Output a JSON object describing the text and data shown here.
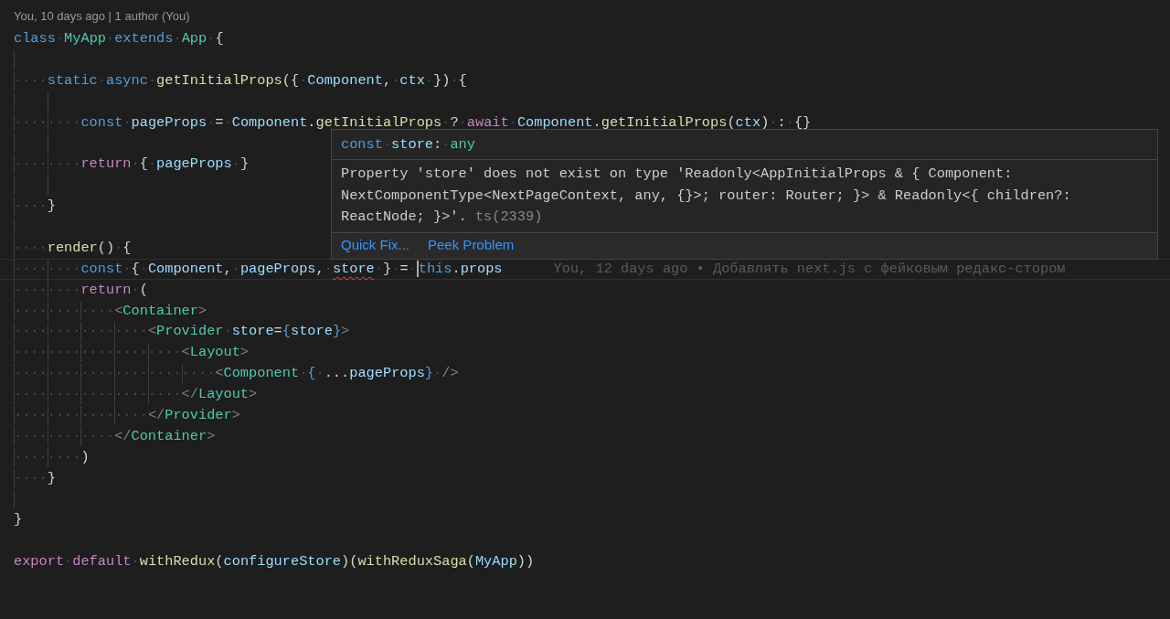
{
  "codelens": "You, 10 days ago | 1 author (You)",
  "lines": [
    {
      "current": false,
      "tokens": [
        {
          "kind": "keyword",
          "text": "class·"
        },
        {
          "kind": "type",
          "text": "MyApp·"
        },
        {
          "kind": "keyword",
          "text": "extends·"
        },
        {
          "kind": "type",
          "text": "App·"
        },
        {
          "kind": "punct",
          "text": "{"
        }
      ]
    },
    {
      "current": false
    },
    {
      "current": false,
      "tokens": [
        {
          "kind": "indent",
          "text": "····"
        },
        {
          "kind": "keyword",
          "text": "static·"
        },
        {
          "kind": "keyword",
          "text": "async·"
        },
        {
          "kind": "function",
          "text": "getInitialProps"
        },
        {
          "kind": "punct",
          "text": "({·"
        },
        {
          "kind": "variable",
          "text": "Component"
        },
        {
          "kind": "punct",
          "text": ",·"
        },
        {
          "kind": "variable",
          "text": "ctx·"
        },
        {
          "kind": "punct",
          "text": "})·{"
        }
      ]
    },
    {
      "current": false
    },
    {
      "current": false,
      "tokens": [
        {
          "kind": "indent",
          "text": "········"
        },
        {
          "kind": "keyword",
          "text": "const·"
        },
        {
          "kind": "variable",
          "text": "pageProps·"
        },
        {
          "kind": "punct",
          "text": "=·"
        },
        {
          "kind": "variable",
          "text": "Component"
        },
        {
          "kind": "punct",
          "text": "."
        },
        {
          "kind": "function",
          "text": "getInitialProps·"
        },
        {
          "kind": "punct",
          "text": "?·"
        },
        {
          "kind": "control",
          "text": "await·"
        },
        {
          "kind": "variable",
          "text": "Component"
        },
        {
          "kind": "punct",
          "text": "."
        },
        {
          "kind": "function",
          "text": "getInitialProps"
        },
        {
          "kind": "punct",
          "text": "("
        },
        {
          "kind": "variable",
          "text": "ctx"
        },
        {
          "kind": "punct",
          "text": ")·:·{}"
        }
      ]
    },
    {
      "current": false
    },
    {
      "current": false,
      "tokens": [
        {
          "kind": "indent",
          "text": "········"
        },
        {
          "kind": "control",
          "text": "return·"
        },
        {
          "kind": "punct",
          "text": "{·"
        },
        {
          "kind": "variable",
          "text": "pageProps·"
        },
        {
          "kind": "punct",
          "text": "}"
        }
      ]
    },
    {
      "current": false
    },
    {
      "current": false,
      "tokens": [
        {
          "kind": "indent",
          "text": "····"
        },
        {
          "kind": "punct",
          "text": "}"
        }
      ]
    },
    {
      "current": false
    },
    {
      "current": false,
      "tokens": [
        {
          "kind": "indent",
          "text": "····"
        },
        {
          "kind": "function",
          "text": "render"
        },
        {
          "kind": "punct",
          "text": "()·{"
        }
      ]
    },
    {
      "current": true,
      "blame": "You, 12 days ago • Добавлять next.js с фейковым редакс-стором",
      "tokens": [
        {
          "kind": "indent",
          "text": "········"
        },
        {
          "kind": "keyword",
          "text": "const·"
        },
        {
          "kind": "punct",
          "text": "{·"
        },
        {
          "kind": "variable",
          "text": "Component"
        },
        {
          "kind": "punct",
          "text": ",·"
        },
        {
          "kind": "variable",
          "text": "pageProps"
        },
        {
          "kind": "punct",
          "text": ",·"
        },
        {
          "kind": "variable",
          "text": "store",
          "error": true
        },
        {
          "kind": "punct",
          "text": "·}·=·"
        },
        {
          "kind": "keyword",
          "text": "this",
          "caret_before": true
        },
        {
          "kind": "punct",
          "text": "."
        },
        {
          "kind": "variable",
          "text": "props"
        }
      ]
    },
    {
      "current": false,
      "tokens": [
        {
          "kind": "indent",
          "text": "········"
        },
        {
          "kind": "control",
          "text": "return·"
        },
        {
          "kind": "punct",
          "text": "("
        }
      ]
    },
    {
      "current": false,
      "tokens": [
        {
          "kind": "indent",
          "text": "············"
        },
        {
          "kind": "angle",
          "text": "<"
        },
        {
          "kind": "tag",
          "text": "Container"
        },
        {
          "kind": "angle",
          "text": ">"
        }
      ]
    },
    {
      "current": false,
      "tokens": [
        {
          "kind": "indent",
          "text": "················"
        },
        {
          "kind": "angle",
          "text": "<"
        },
        {
          "kind": "tag",
          "text": "Provider·"
        },
        {
          "kind": "variable",
          "text": "store"
        },
        {
          "kind": "punct",
          "text": "="
        },
        {
          "kind": "brace",
          "text": "{"
        },
        {
          "kind": "variable",
          "text": "store"
        },
        {
          "kind": "brace",
          "text": "}"
        },
        {
          "kind": "angle",
          "text": ">"
        }
      ]
    },
    {
      "current": false,
      "tokens": [
        {
          "kind": "indent",
          "text": "····················"
        },
        {
          "kind": "angle",
          "text": "<"
        },
        {
          "kind": "tag",
          "text": "Layout"
        },
        {
          "kind": "angle",
          "text": ">"
        }
      ]
    },
    {
      "current": false,
      "tokens": [
        {
          "kind": "indent",
          "text": "························"
        },
        {
          "kind": "angle",
          "text": "<"
        },
        {
          "kind": "tag",
          "text": "Component·"
        },
        {
          "kind": "brace",
          "text": "{·"
        },
        {
          "kind": "punct",
          "text": "..."
        },
        {
          "kind": "variable",
          "text": "pageProps"
        },
        {
          "kind": "brace",
          "text": "}·"
        },
        {
          "kind": "angle",
          "text": "/>"
        }
      ]
    },
    {
      "current": false,
      "tokens": [
        {
          "kind": "indent",
          "text": "····················"
        },
        {
          "kind": "angle",
          "text": "</"
        },
        {
          "kind": "tag",
          "text": "Layout"
        },
        {
          "kind": "angle",
          "text": ">"
        }
      ]
    },
    {
      "current": false,
      "tokens": [
        {
          "kind": "indent",
          "text": "················"
        },
        {
          "kind": "angle",
          "text": "</"
        },
        {
          "kind": "tag",
          "text": "Provider"
        },
        {
          "kind": "angle",
          "text": ">"
        }
      ]
    },
    {
      "current": false,
      "tokens": [
        {
          "kind": "indent",
          "text": "············"
        },
        {
          "kind": "angle",
          "text": "</"
        },
        {
          "kind": "tag",
          "text": "Container"
        },
        {
          "kind": "angle",
          "text": ">"
        }
      ]
    },
    {
      "current": false,
      "tokens": [
        {
          "kind": "indent",
          "text": "········"
        },
        {
          "kind": "punct",
          "text": ")"
        }
      ]
    },
    {
      "current": false,
      "tokens": [
        {
          "kind": "indent",
          "text": "····"
        },
        {
          "kind": "punct",
          "text": "}"
        }
      ]
    },
    {
      "current": false
    },
    {
      "current": false,
      "tokens": [
        {
          "kind": "punct",
          "text": "}"
        }
      ]
    },
    {
      "current": false
    },
    {
      "current": false,
      "tokens": [
        {
          "kind": "control",
          "text": "export·"
        },
        {
          "kind": "control",
          "text": "default·"
        },
        {
          "kind": "function",
          "text": "withRedux"
        },
        {
          "kind": "punct",
          "text": "("
        },
        {
          "kind": "variable",
          "text": "configureStore"
        },
        {
          "kind": "punct",
          "text": ")("
        },
        {
          "kind": "function",
          "text": "withReduxSaga"
        },
        {
          "kind": "punct",
          "text": "("
        },
        {
          "kind": "variable",
          "text": "MyApp"
        },
        {
          "kind": "punct",
          "text": "))"
        }
      ]
    }
  ],
  "hover": {
    "signature": [
      {
        "kind": "keyword",
        "text": "const·"
      },
      {
        "kind": "variable",
        "text": "store"
      },
      {
        "kind": "punct",
        "text": ":·"
      },
      {
        "kind": "type",
        "text": "any"
      }
    ],
    "message": "Property 'store' does not exist on type 'Readonly<AppInitialProps & { Component: NextComponentType<NextPageContext, any, {}>; router: Router; }> & Readonly<{ children?: ReactNode; }>'.",
    "error_code": "ts(2339)",
    "actions": [
      "Quick Fix...",
      "Peek Problem"
    ]
  }
}
